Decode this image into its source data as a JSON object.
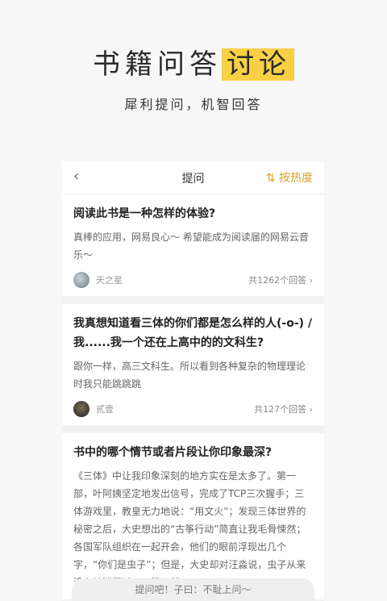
{
  "hero": {
    "title_main": "书籍问答",
    "title_highlight": "讨论",
    "subtitle": "犀利提问，机智回答"
  },
  "nav": {
    "back_icon": "chevron-left",
    "title": "提问",
    "sort_label": "⇅ 按热度"
  },
  "questions": [
    {
      "question": "阅读此书是一种怎样的体验?",
      "answer": "真棒的应用，网易良心～ 希望能成为阅读届的网易云音乐～",
      "user": "天之星",
      "count": "共1262个回答 ›"
    },
    {
      "question": "我真想知道看三体的你们都是怎么样的人(-o-) / 我......我一个还在上高中的的文科生?",
      "answer": "跟你一样，高三文科生。所以看到各种复杂的物理理论时我只能跳跳跳",
      "user": "贰壹",
      "count": "共127个回答 ›"
    },
    {
      "question": "书中的哪个情节或者片段让你印象最深?",
      "answer": "《三体》中让我印象深刻的地方实在是太多了。第一部，叶阿姨坚定地发出信号，完成了TCP三次握手；三体游戏里，教皇无力地说：“用文火”；发现三体世界的秘密之后，大史想出的“古筝行动”简直让我毛骨悚然；各国军队组织在一起开会，他们的眼前浮现出几个字，“你们是虫子”；但是，大史却对汪淼说，虫子从来没有被消灭过……第二部"
    }
  ],
  "bottom_bar": {
    "placeholder": "提问吧！子曰：不耻上问～"
  }
}
